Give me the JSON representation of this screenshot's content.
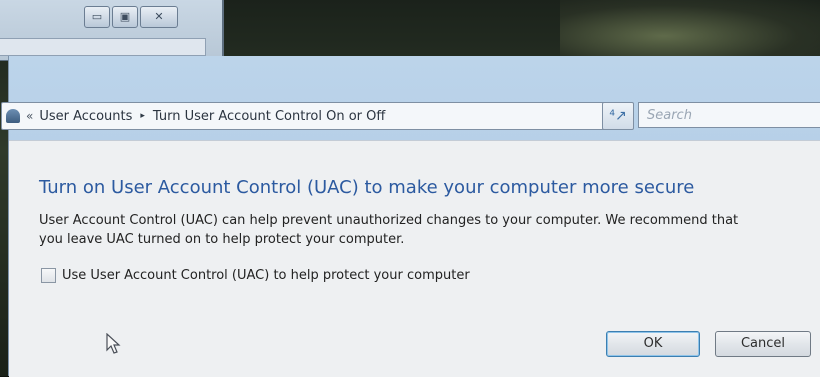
{
  "background_window": {
    "caption_buttons": [
      "minimize",
      "maximize",
      "close"
    ]
  },
  "address_bar": {
    "back_glyph": "«",
    "breadcrumb": [
      "User Accounts",
      "Turn User Account Control On or Off"
    ],
    "separator_glyph": "▸",
    "dropdown_glyph": "▾",
    "refresh_glyph": "⁴↗"
  },
  "search": {
    "placeholder": "Search"
  },
  "main": {
    "heading": "Turn on User Account Control (UAC) to make your computer more secure",
    "description_line1": "User Account Control (UAC) can help prevent unauthorized changes to your computer.  We recommend that",
    "description_line2": "you leave UAC turned on to help protect your computer.",
    "checkbox_label": "Use User Account Control (UAC) to help protect your computer",
    "checkbox_checked": false
  },
  "buttons": {
    "ok": "OK",
    "cancel": "Cancel"
  },
  "colors": {
    "heading": "#2c5aa0",
    "ok_border": "#3c7fb1",
    "chrome": "#bcd4ea"
  }
}
